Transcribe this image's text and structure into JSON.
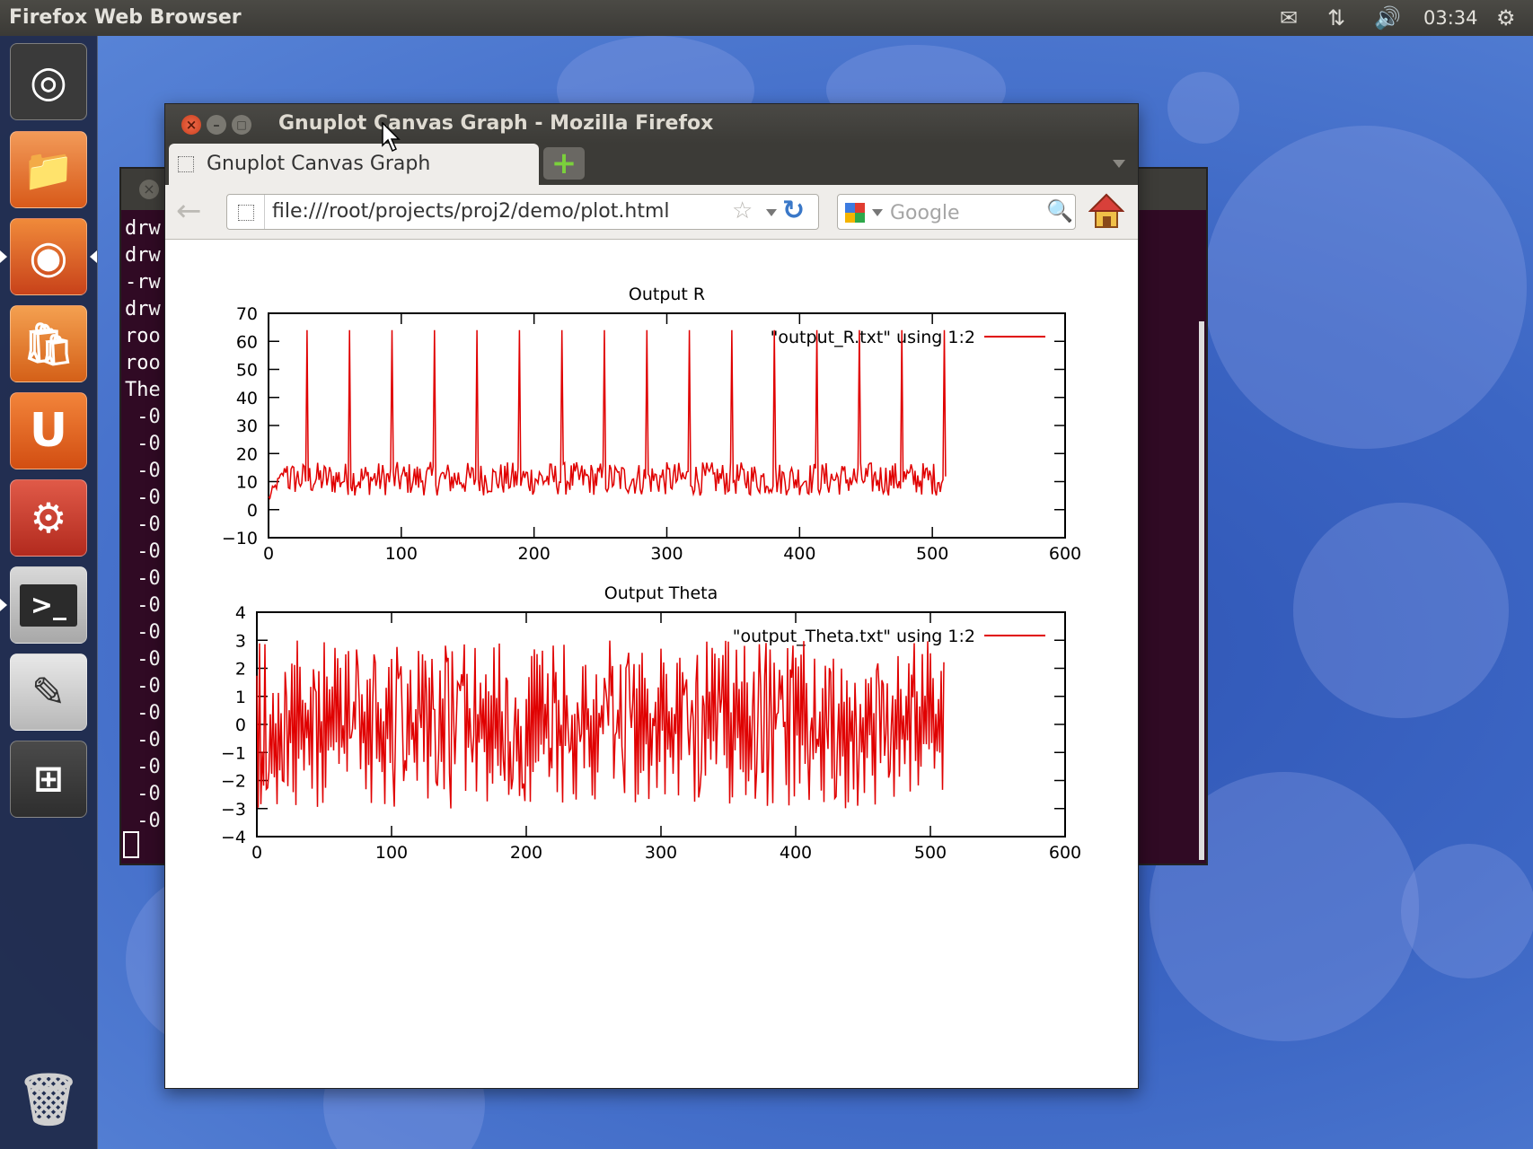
{
  "top_panel": {
    "app_title": "Firefox Web Browser",
    "clock": "03:34"
  },
  "terminal": {
    "lines": [
      "drw",
      "drw",
      "-rw",
      "drw",
      "roo",
      "roo",
      "The",
      " -0",
      " -0",
      " -0",
      " -0",
      " -0",
      " -0",
      " -0",
      " -0",
      " -0",
      " -0",
      " -0",
      " -0",
      " -0",
      " -0",
      " -0",
      " -0"
    ]
  },
  "firefox": {
    "window_title": "Gnuplot Canvas Graph - Mozilla Firefox",
    "tab_label": "Gnuplot Canvas Graph",
    "url": "file:///root/projects/proj2/demo/plot.html",
    "search_placeholder": "Google"
  },
  "colors": {
    "series_color": "#e00000",
    "terminal_bg": "#300a24"
  },
  "chart_data": [
    {
      "type": "line",
      "title": "Output R",
      "xlabel": "",
      "ylabel": "",
      "xlim": [
        0,
        600
      ],
      "ylim": [
        -10,
        70
      ],
      "xticks": [
        0,
        100,
        200,
        300,
        400,
        500,
        600
      ],
      "yticks": [
        -10,
        0,
        10,
        20,
        30,
        40,
        50,
        60,
        70
      ],
      "legend_position": "top-right",
      "series": [
        {
          "name": "\"output_R.txt\" using 1:2",
          "x_range": [
            0,
            510
          ],
          "baseline_range": [
            5,
            17
          ],
          "peak_x": [
            29,
            61,
            93,
            125,
            157,
            189,
            221,
            253,
            285,
            317,
            349,
            381,
            413,
            445,
            477,
            509
          ],
          "peak_y": 64
        }
      ]
    },
    {
      "type": "line",
      "title": "Output Theta",
      "xlabel": "",
      "ylabel": "",
      "xlim": [
        0,
        600
      ],
      "ylim": [
        -4,
        4
      ],
      "xticks": [
        0,
        100,
        200,
        300,
        400,
        500,
        600
      ],
      "yticks": [
        -4,
        -3,
        -2,
        -1,
        0,
        1,
        2,
        3,
        4
      ],
      "legend_position": "top-right",
      "series": [
        {
          "name": "\"output_Theta.txt\" using 1:2",
          "x_range": [
            0,
            510
          ],
          "y_range": [
            -3,
            3
          ]
        }
      ]
    }
  ]
}
